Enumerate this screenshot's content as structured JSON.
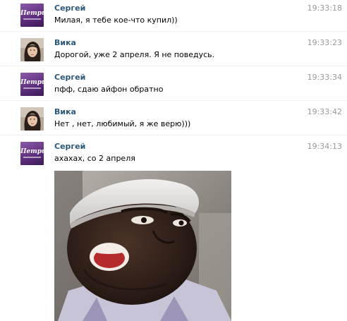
{
  "messages": [
    {
      "author": "Сергей",
      "text": "Милая, я тебе кое-что купил))",
      "time": "19:33:18"
    },
    {
      "author": "Вика",
      "text": "Дорогой, уже 2 апреля. Я не поведусь.",
      "time": "19:33:23"
    },
    {
      "author": "Сергей",
      "text": "пфф, сдаю айфон обратно",
      "time": "19:33:34"
    },
    {
      "author": "Вика",
      "text": "Нет , нет, любимый, я же верю)))",
      "time": "19:33:42"
    },
    {
      "author": "Сергей",
      "text": "ахахах, со 2 апреля",
      "time": "19:34:13"
    }
  ],
  "avatar_logo_text": "Петрик",
  "colors": {
    "author": "#2b587a",
    "time": "#999999",
    "brand_avatar": "#5c2d7c"
  }
}
